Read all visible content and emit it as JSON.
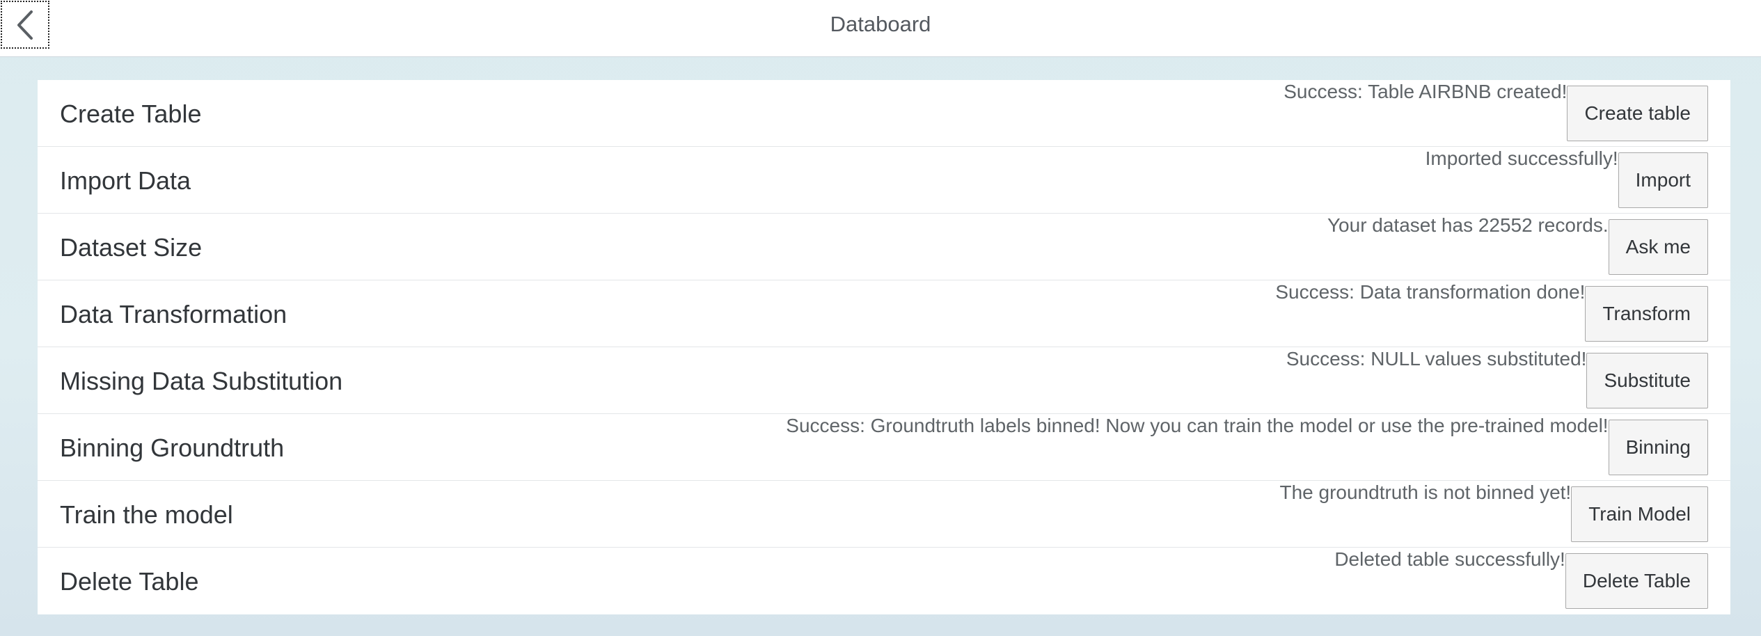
{
  "header": {
    "title": "Databoard",
    "back_icon": "chevron-left-icon"
  },
  "rows": [
    {
      "label": "Create Table",
      "status": "Success: Table AIRBNB created!",
      "button": "Create table"
    },
    {
      "label": "Import Data",
      "status": "Imported successfully!",
      "button": "Import"
    },
    {
      "label": "Dataset Size",
      "status": "Your dataset has 22552 records.",
      "button": "Ask me"
    },
    {
      "label": "Data Transformation",
      "status": "Success: Data transformation done!",
      "button": "Transform"
    },
    {
      "label": "Missing Data Substitution",
      "status": "Success: NULL values substituted!",
      "button": "Substitute"
    },
    {
      "label": "Binning Groundtruth",
      "status": "Success: Groundtruth labels binned! Now you can train the model or use the pre-trained model!",
      "button": "Binning"
    },
    {
      "label": "Train the model",
      "status": "The groundtruth is not binned yet!",
      "button": "Train Model"
    },
    {
      "label": "Delete Table",
      "status": "Deleted table successfully!",
      "button": "Delete Table"
    }
  ]
}
